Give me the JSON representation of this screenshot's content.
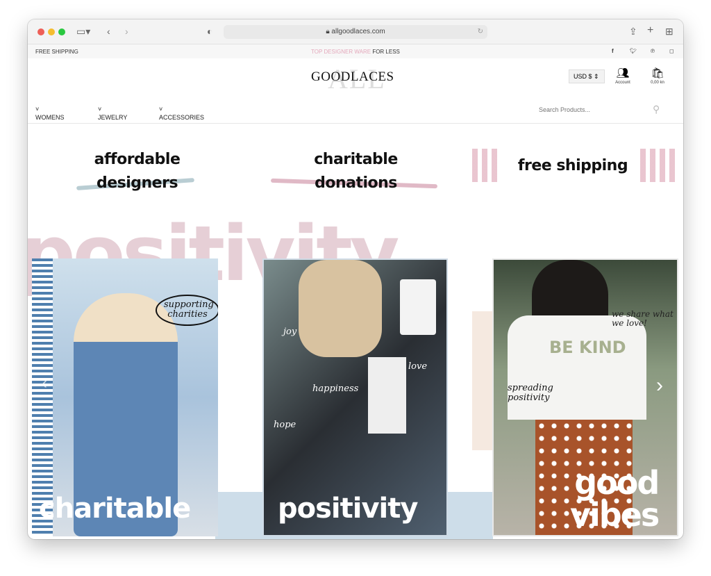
{
  "browser": {
    "url": "allgoodlaces.com"
  },
  "topbar": {
    "left": "FREE SHIPPING",
    "promo_highlight": "TOP DESIGNER WARE",
    "promo_rest": " FOR LESS",
    "social": [
      "facebook-icon",
      "twitter-icon",
      "pinterest-icon",
      "instagram-icon"
    ]
  },
  "header": {
    "logo": "GOODLACES",
    "logo_back": "ALL",
    "currency": "USD $",
    "account": "Account",
    "cart": "0,00 kn"
  },
  "nav": {
    "items": [
      "WOMENS",
      "JEWELRY",
      "ACCESSORIES"
    ],
    "search_placeholder": "Search Products..."
  },
  "features": [
    {
      "line1": "affordable",
      "line2": "designers"
    },
    {
      "line1": "charitable",
      "line2": "donations"
    },
    {
      "line1": "free shipping"
    }
  ],
  "hero": {
    "background_word": "positivity",
    "cards": [
      {
        "caption": "charitable",
        "notes": [
          "supporting charities"
        ]
      },
      {
        "caption": "positivity",
        "notes": [
          "joy",
          "happiness",
          "love",
          "hope"
        ]
      },
      {
        "caption_line1": "good",
        "caption_line2": "vibes",
        "notes": [
          "we share what we love!",
          "spreading positivity",
          "BE KIND"
        ]
      }
    ]
  },
  "colors": {
    "pink": "#e4b7c4",
    "blue": "#b8cfe0"
  }
}
